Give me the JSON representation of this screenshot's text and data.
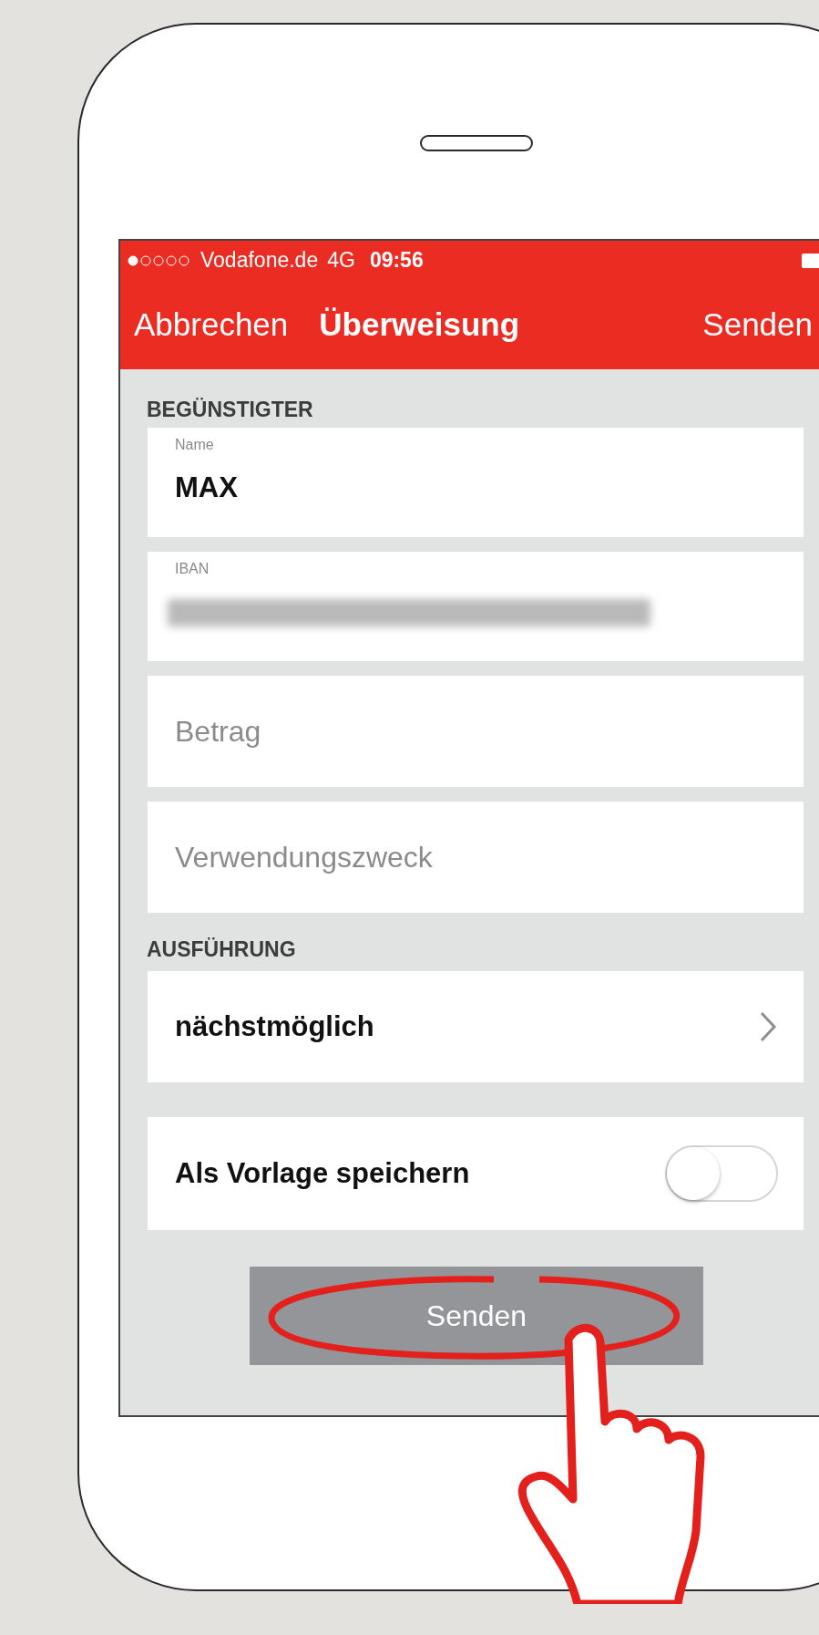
{
  "status_bar": {
    "carrier": "Vodafone.de",
    "network": "4G",
    "time": "09:56"
  },
  "nav_bar": {
    "cancel": "Abbrechen",
    "title": "Überweisung",
    "send": "Senden"
  },
  "beneficiary": {
    "header": "BEGÜNSTIGTER",
    "fields": [
      {
        "kind": "filled",
        "label": "Name",
        "value": "MAX"
      },
      {
        "kind": "redacted",
        "label": "IBAN"
      },
      {
        "kind": "empty",
        "placeholder": "Betrag"
      },
      {
        "kind": "empty",
        "placeholder": "Verwendungszweck"
      }
    ]
  },
  "execution": {
    "header": "AUSFÜHRUNG",
    "value": "nächstmöglich"
  },
  "template": {
    "label": "Als Vorlage speichern",
    "on": false
  },
  "send_button": {
    "label": "Senden",
    "highlighted": true
  }
}
